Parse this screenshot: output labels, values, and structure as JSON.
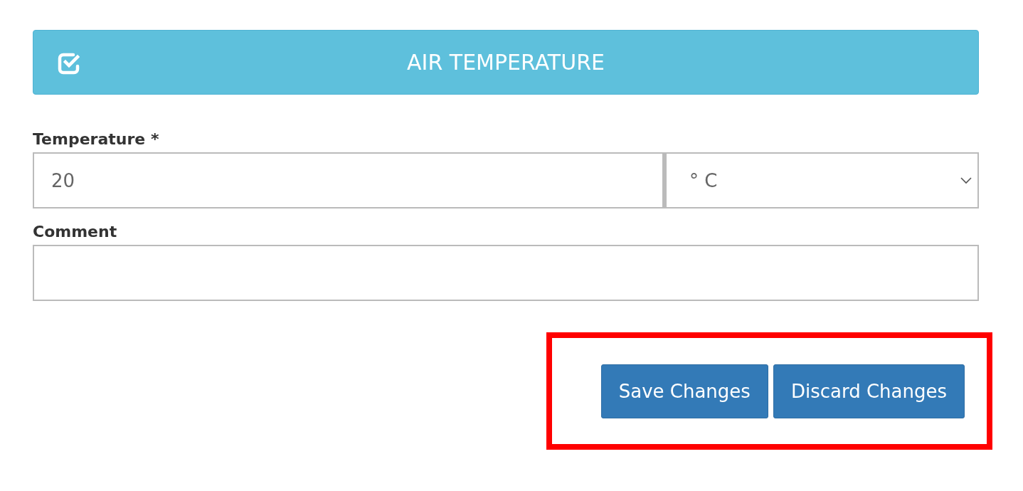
{
  "header": {
    "title": "AIR TEMPERATURE"
  },
  "fields": [
    {
      "kind": "value-unit",
      "label": "Temperature *",
      "value": "20",
      "unit": "° C"
    },
    {
      "kind": "text",
      "label": "Comment"
    }
  ],
  "buttons": [
    "Save Changes",
    "Discard Changes"
  ]
}
